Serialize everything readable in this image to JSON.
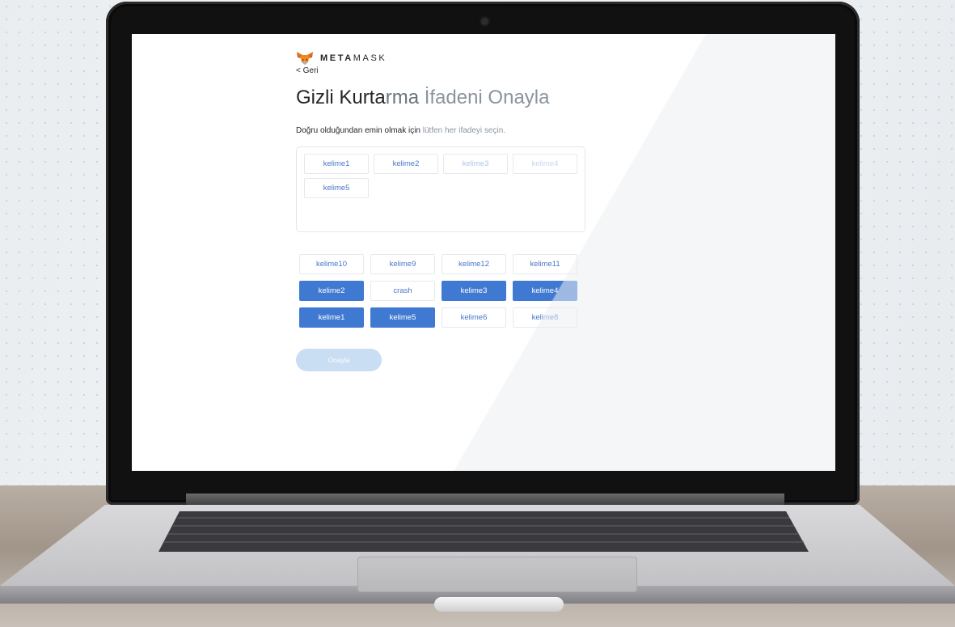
{
  "brand": {
    "name_bold": "META",
    "name_light": "MASK"
  },
  "nav": {
    "back_label": "< Geri"
  },
  "page": {
    "title_part1": "Gizli Kurta",
    "title_part2": "rma ",
    "title_part3": "İfadeni Onayla",
    "instruction_strong": "Doğru olduğundan emin olmak için",
    "instruction_muted": " lütfen her ifadeyi seçin."
  },
  "selected_words": [
    {
      "label": "kelime1",
      "state": "normal"
    },
    {
      "label": "kelime2",
      "state": "normal"
    },
    {
      "label": "kelime3",
      "state": "faded"
    },
    {
      "label": "kelime4",
      "state": "faded2"
    },
    {
      "label": "kelime5",
      "state": "normal"
    }
  ],
  "word_pool": [
    {
      "label": "kelime10",
      "selected": false
    },
    {
      "label": "kelime9",
      "selected": false
    },
    {
      "label": "kelime12",
      "selected": false
    },
    {
      "label": "kelime11",
      "selected": false
    },
    {
      "label": "kelime2",
      "selected": true
    },
    {
      "label": "crash",
      "selected": false
    },
    {
      "label": "kelime3",
      "selected": true
    },
    {
      "label": "kelime4",
      "selected": true
    },
    {
      "label": "kelime1",
      "selected": true
    },
    {
      "label": "kelime5",
      "selected": true
    },
    {
      "label": "kelime6",
      "selected": false
    },
    {
      "label": "kelime8",
      "selected": false
    }
  ],
  "actions": {
    "confirm_label": "Onayla"
  },
  "colors": {
    "accent": "#3f79d1",
    "link": "#4a78c8",
    "disabled_button": "#c9ddf3",
    "text": "#24272a"
  },
  "icons": {
    "logo": "fox-icon"
  }
}
